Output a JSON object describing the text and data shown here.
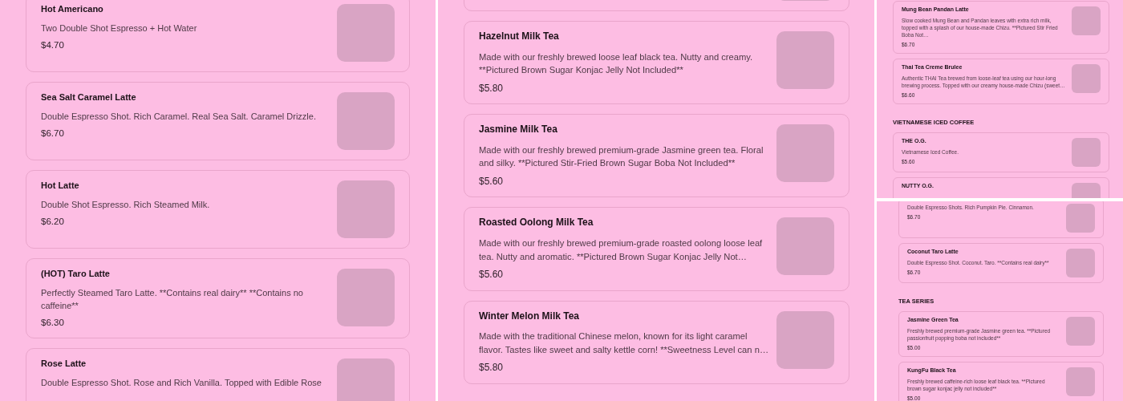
{
  "panels": [
    {
      "items": [
        {
          "kind": "card",
          "name": "Hot Americano",
          "description": "Two Double Shot Espresso + Hot Water",
          "price": "$4.70"
        },
        {
          "kind": "card",
          "name": "Sea Salt Caramel Latte",
          "description": "Double Espresso Shot. Rich Caramel. Real Sea Salt. Caramel Drizzle.",
          "price": "$6.70"
        },
        {
          "kind": "card",
          "name": "Hot Latte",
          "description": "Double Shot Espresso. Rich Steamed Milk.",
          "price": "$6.20"
        },
        {
          "kind": "card",
          "name": "(HOT) Taro Latte",
          "description": "Perfectly Steamed Taro Latte. **Contains real dairy** **Contains no caffeine**",
          "price": "$6.30"
        },
        {
          "kind": "card",
          "name": "Rose Latte",
          "description": "Double Espresso Shot. Rose and Rich Vanilla. Topped with Edible Rose"
        }
      ]
    },
    {
      "items": [
        {
          "kind": "card"
        },
        {
          "kind": "card",
          "name": "Hazelnut Milk Tea",
          "description": "Made with our freshly brewed loose leaf black tea. Nutty and creamy. **Pictured Brown Sugar Konjac Jelly Not Included**",
          "price": "$5.80"
        },
        {
          "kind": "card",
          "name": "Jasmine Milk Tea",
          "description": "Made with our freshly brewed premium-grade Jasmine green tea. Floral and silky. **Pictured Stir-Fried Brown Sugar Boba Not Included**",
          "price": "$5.60"
        },
        {
          "kind": "card",
          "name": "Roasted Oolong Milk Tea",
          "description": "Made with our freshly brewed premium-grade roasted oolong loose leaf tea. Nutty and aromatic. **Pictured Brown Sugar Konjac Jelly Not…",
          "price": "$5.60"
        },
        {
          "kind": "card",
          "name": "Winter Melon Milk Tea",
          "description": "Made with the traditional Chinese melon, known for its light caramel flavor. Tastes like sweet and salty kettle corn! **Sweetness Level can n…",
          "price": "$5.80"
        }
      ]
    },
    {
      "items": [
        {
          "kind": "card",
          "name": "Mung Bean Pandan Latte",
          "description": "Slow cooked Mung Bean and Pandan leaves with extra rich milk, topped with a splash of our house-made Chizu. **Pictured Stir Fried Boba Not…",
          "price": "$6.70"
        },
        {
          "kind": "card",
          "name": "Thai Tea Creme Brulee",
          "description": "Authentic THAI Tea brewed from loose-leaf tea using our hour-long brewing process. Topped with our creamy house-made Chizu (sweet…",
          "price": "$6.60"
        },
        {
          "kind": "heading",
          "text": "VIETNAMESE ICED COFFEE"
        },
        {
          "kind": "card",
          "name": "THE O.G.",
          "description": "Vietnamese Iced Coffee.",
          "price": "$5.60"
        },
        {
          "kind": "card",
          "name": "NUTTY O.G."
        }
      ]
    },
    {
      "items": [
        {
          "kind": "card",
          "description": "Double Espresso Shots. Rich Pumpkin Pie. Cinnamon.",
          "price": "$6.70"
        },
        {
          "kind": "card",
          "name": "Coconut Taro Latte",
          "description": "Double Espresso Shot. Coconut. Taro.  **Contains real dairy**",
          "price": "$6.70"
        },
        {
          "kind": "heading",
          "text": "TEA SERIES"
        },
        {
          "kind": "card",
          "name": "Jasmine Green Tea",
          "description": "Freshly brewed premium-grade Jasmine green tea. **Pictured passionfruit popping boba not included**",
          "price": "$5.00"
        },
        {
          "kind": "card",
          "name": "KungFu Black Tea",
          "description": "Freshly brewed caffeine-rich loose leaf black tea. **Pictured brown sugar konjac jelly not included**",
          "price": "$5.00"
        }
      ]
    }
  ]
}
